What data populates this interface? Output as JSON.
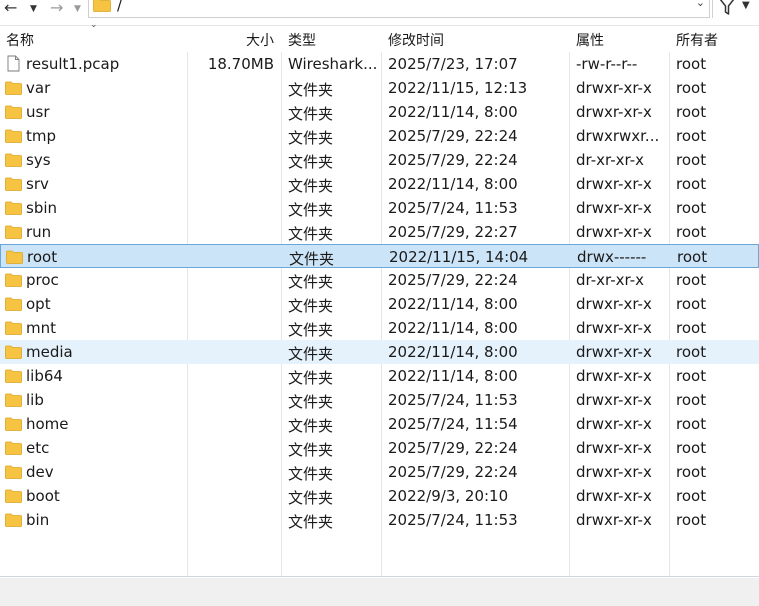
{
  "toolbar": {
    "back_icon": "arrow-left-icon",
    "forward_icon": "arrow-right-icon",
    "path": "/",
    "filter_icon": "filter-icon"
  },
  "columns": {
    "name": "名称",
    "size": "大小",
    "type": "类型",
    "modified": "修改时间",
    "permissions": "属性",
    "owner": "所有者"
  },
  "files": [
    {
      "name": "result1.pcap",
      "size": "18.70MB",
      "type": "Wireshark...",
      "modified": "2025/7/23, 17:07",
      "permissions": "-rw-r--r--",
      "owner": "root",
      "kind": "file"
    },
    {
      "name": "var",
      "size": "",
      "type": "文件夹",
      "modified": "2022/11/15, 12:13",
      "permissions": "drwxr-xr-x",
      "owner": "root",
      "kind": "folder"
    },
    {
      "name": "usr",
      "size": "",
      "type": "文件夹",
      "modified": "2022/11/14, 8:00",
      "permissions": "drwxr-xr-x",
      "owner": "root",
      "kind": "folder"
    },
    {
      "name": "tmp",
      "size": "",
      "type": "文件夹",
      "modified": "2025/7/29, 22:24",
      "permissions": "drwxrwxr...",
      "owner": "root",
      "kind": "folder"
    },
    {
      "name": "sys",
      "size": "",
      "type": "文件夹",
      "modified": "2025/7/29, 22:24",
      "permissions": "dr-xr-xr-x",
      "owner": "root",
      "kind": "folder"
    },
    {
      "name": "srv",
      "size": "",
      "type": "文件夹",
      "modified": "2022/11/14, 8:00",
      "permissions": "drwxr-xr-x",
      "owner": "root",
      "kind": "folder"
    },
    {
      "name": "sbin",
      "size": "",
      "type": "文件夹",
      "modified": "2025/7/24, 11:53",
      "permissions": "drwxr-xr-x",
      "owner": "root",
      "kind": "folder"
    },
    {
      "name": "run",
      "size": "",
      "type": "文件夹",
      "modified": "2025/7/29, 22:27",
      "permissions": "drwxr-xr-x",
      "owner": "root",
      "kind": "folder"
    },
    {
      "name": "root",
      "size": "",
      "type": "文件夹",
      "modified": "2022/11/15, 14:04",
      "permissions": "drwx------",
      "owner": "root",
      "kind": "folder",
      "state": "selected"
    },
    {
      "name": "proc",
      "size": "",
      "type": "文件夹",
      "modified": "2025/7/29, 22:24",
      "permissions": "dr-xr-xr-x",
      "owner": "root",
      "kind": "folder"
    },
    {
      "name": "opt",
      "size": "",
      "type": "文件夹",
      "modified": "2022/11/14, 8:00",
      "permissions": "drwxr-xr-x",
      "owner": "root",
      "kind": "folder"
    },
    {
      "name": "mnt",
      "size": "",
      "type": "文件夹",
      "modified": "2022/11/14, 8:00",
      "permissions": "drwxr-xr-x",
      "owner": "root",
      "kind": "folder"
    },
    {
      "name": "media",
      "size": "",
      "type": "文件夹",
      "modified": "2022/11/14, 8:00",
      "permissions": "drwxr-xr-x",
      "owner": "root",
      "kind": "folder",
      "state": "hover"
    },
    {
      "name": "lib64",
      "size": "",
      "type": "文件夹",
      "modified": "2022/11/14, 8:00",
      "permissions": "drwxr-xr-x",
      "owner": "root",
      "kind": "folder"
    },
    {
      "name": "lib",
      "size": "",
      "type": "文件夹",
      "modified": "2025/7/24, 11:53",
      "permissions": "drwxr-xr-x",
      "owner": "root",
      "kind": "folder"
    },
    {
      "name": "home",
      "size": "",
      "type": "文件夹",
      "modified": "2025/7/24, 11:54",
      "permissions": "drwxr-xr-x",
      "owner": "root",
      "kind": "folder"
    },
    {
      "name": "etc",
      "size": "",
      "type": "文件夹",
      "modified": "2025/7/29, 22:24",
      "permissions": "drwxr-xr-x",
      "owner": "root",
      "kind": "folder"
    },
    {
      "name": "dev",
      "size": "",
      "type": "文件夹",
      "modified": "2025/7/29, 22:24",
      "permissions": "drwxr-xr-x",
      "owner": "root",
      "kind": "folder"
    },
    {
      "name": "boot",
      "size": "",
      "type": "文件夹",
      "modified": "2022/9/3, 20:10",
      "permissions": "drwxr-xr-x",
      "owner": "root",
      "kind": "folder"
    },
    {
      "name": "bin",
      "size": "",
      "type": "文件夹",
      "modified": "2025/7/24, 11:53",
      "permissions": "drwxr-xr-x",
      "owner": "root",
      "kind": "folder"
    }
  ],
  "colors": {
    "folder": "#f6c343",
    "selected_bg": "#cce4f7",
    "selected_border": "#6aa7d8",
    "hover_bg": "#e5f1fb"
  }
}
